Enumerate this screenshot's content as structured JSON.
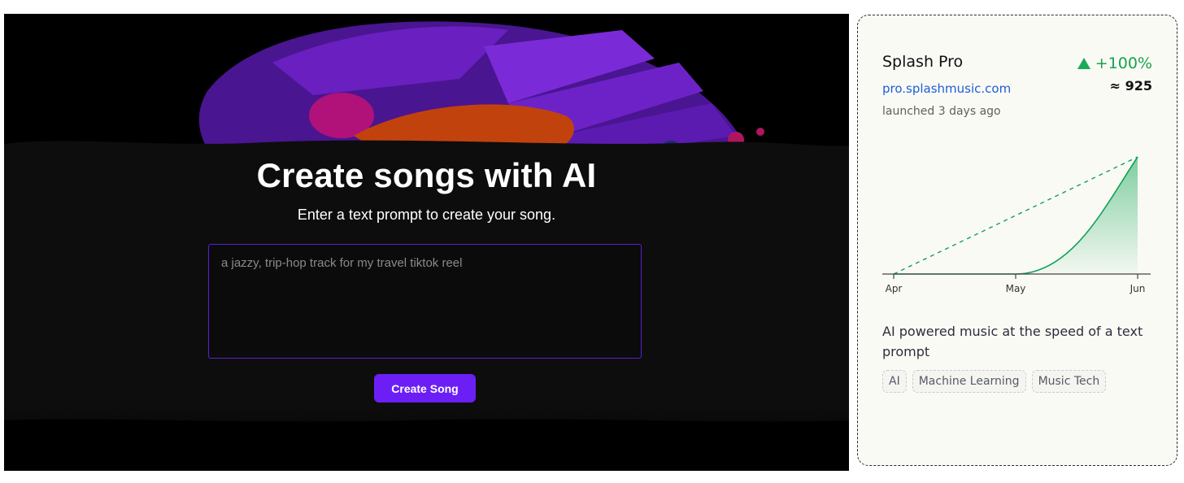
{
  "hero": {
    "title": "Create songs with AI",
    "subtitle": "Enter a text prompt to create your song.",
    "prompt_placeholder": "a jazzy, trip-hop track for my travel tiktok reel",
    "button_label": "Create Song"
  },
  "card": {
    "name": "Splash Pro",
    "url": "pro.splashmusic.com",
    "launched": "launched 3 days ago",
    "growth": "+100%",
    "approx": "≈ 925",
    "description": "AI powered music at the speed of a text prompt",
    "tags": [
      "AI",
      "Machine Learning",
      "Music Tech"
    ],
    "colors": {
      "accent": "#16a34a",
      "link": "#1d5fd6",
      "button": "#6b1ff5"
    }
  },
  "chart_data": {
    "type": "area",
    "x": [
      "Apr",
      "May",
      "Jun"
    ],
    "series": [
      {
        "values": [
          0,
          0,
          925
        ]
      }
    ],
    "trend_line": {
      "from": [
        "Apr",
        0
      ],
      "to": [
        "Jun",
        925
      ],
      "style": "dashed"
    },
    "grid": false
  }
}
